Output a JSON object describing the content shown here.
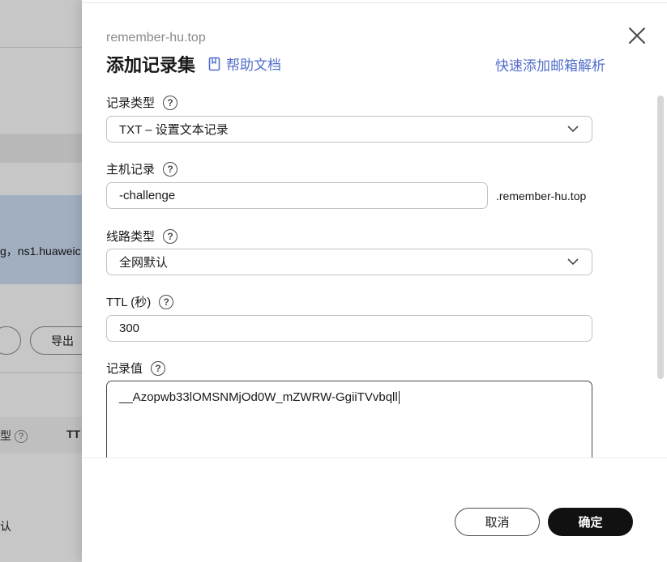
{
  "background": {
    "info_text": "g，ns1.huaweic",
    "export_button": "导出",
    "table_header_type": "型",
    "table_header_ttl": "TT",
    "row_cell": "认"
  },
  "drawer": {
    "domain": "remember-hu.top",
    "title": "添加记录集",
    "help_link": "帮助文档",
    "quick_link": "快速添加邮箱解析",
    "record_type": {
      "label": "记录类型",
      "value": "TXT – 设置文本记录"
    },
    "host": {
      "label": "主机记录",
      "value": "-challenge",
      "suffix": ".remember-hu.top"
    },
    "line_type": {
      "label": "线路类型",
      "value": "全网默认"
    },
    "ttl": {
      "label": "TTL (秒)",
      "value": "300"
    },
    "record_value": {
      "label": "记录值",
      "value": "__Azopwb33lOMSNMjOd0W_mZWRW-GgiiTVvbqll"
    },
    "cancel_button": "取消",
    "ok_button": "确定"
  },
  "icons": {
    "close": "close-icon",
    "help": "book-icon",
    "question": "question-icon",
    "dropdown": "chevron-down-icon"
  },
  "colors": {
    "link": "#526ecc",
    "primary_button": "#111111"
  }
}
